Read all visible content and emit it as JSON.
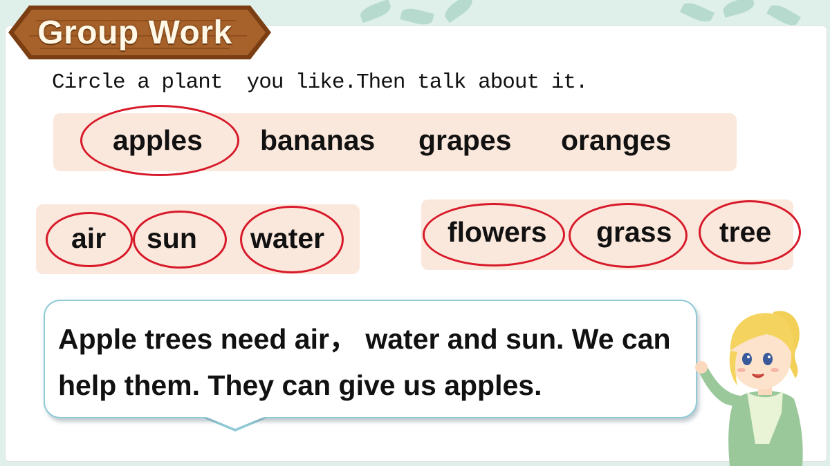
{
  "header": {
    "title": "Group Work"
  },
  "instruction": "Circle a plant  you like.Then talk about it.",
  "fruits": [
    {
      "label": "apples",
      "circled": true
    },
    {
      "label": "bananas",
      "circled": false
    },
    {
      "label": "grapes",
      "circled": false
    },
    {
      "label": "oranges",
      "circled": false
    }
  ],
  "needs": [
    {
      "label": "air",
      "circled": true
    },
    {
      "label": "sun",
      "circled": true
    },
    {
      "label": "water",
      "circled": true
    }
  ],
  "plants": [
    {
      "label": "flowers",
      "circled": true
    },
    {
      "label": "grass",
      "circled": true
    },
    {
      "label": "tree",
      "circled": true
    }
  ],
  "speech": {
    "text": "Apple trees need air， water and sun. We can help them. They can give us apples."
  },
  "colors": {
    "panel": "#fbe8dc",
    "circle": "#d7192a",
    "banner": "#a7612a",
    "bubble_border": "#8fcad6"
  }
}
